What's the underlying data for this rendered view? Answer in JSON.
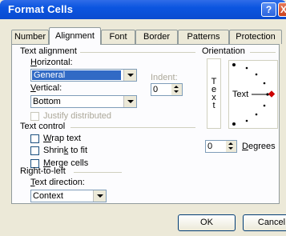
{
  "window": {
    "title": "Format Cells",
    "help": "?",
    "close": "X"
  },
  "tabs": [
    "Number",
    "Alignment",
    "Font",
    "Border",
    "Patterns",
    "Protection"
  ],
  "text_alignment": {
    "group_title": "Text alignment",
    "horizontal_label": "Horizontal:",
    "horizontal_value": "General",
    "vertical_label": "Vertical:",
    "vertical_value": "Bottom",
    "indent_label": "Indent:",
    "indent_value": "0",
    "justify_distributed": "Justify distributed"
  },
  "text_control": {
    "group_title": "Text control",
    "wrap_text": "Wrap text",
    "shrink_to_fit": "Shrink to fit",
    "merge_cells": "Merge cells"
  },
  "right_to_left": {
    "group_title": "Right-to-left",
    "direction_label": "Text direction:",
    "direction_value": "Context"
  },
  "orientation": {
    "group_title": "Orientation",
    "vertical_text": [
      "T",
      "e",
      "x",
      "t"
    ],
    "dial_text": "Text",
    "degrees_value": "0",
    "degrees_label": "Degrees",
    "accent_color": "#cc0000"
  },
  "footer": {
    "ok": "OK",
    "cancel": "Cancel"
  }
}
